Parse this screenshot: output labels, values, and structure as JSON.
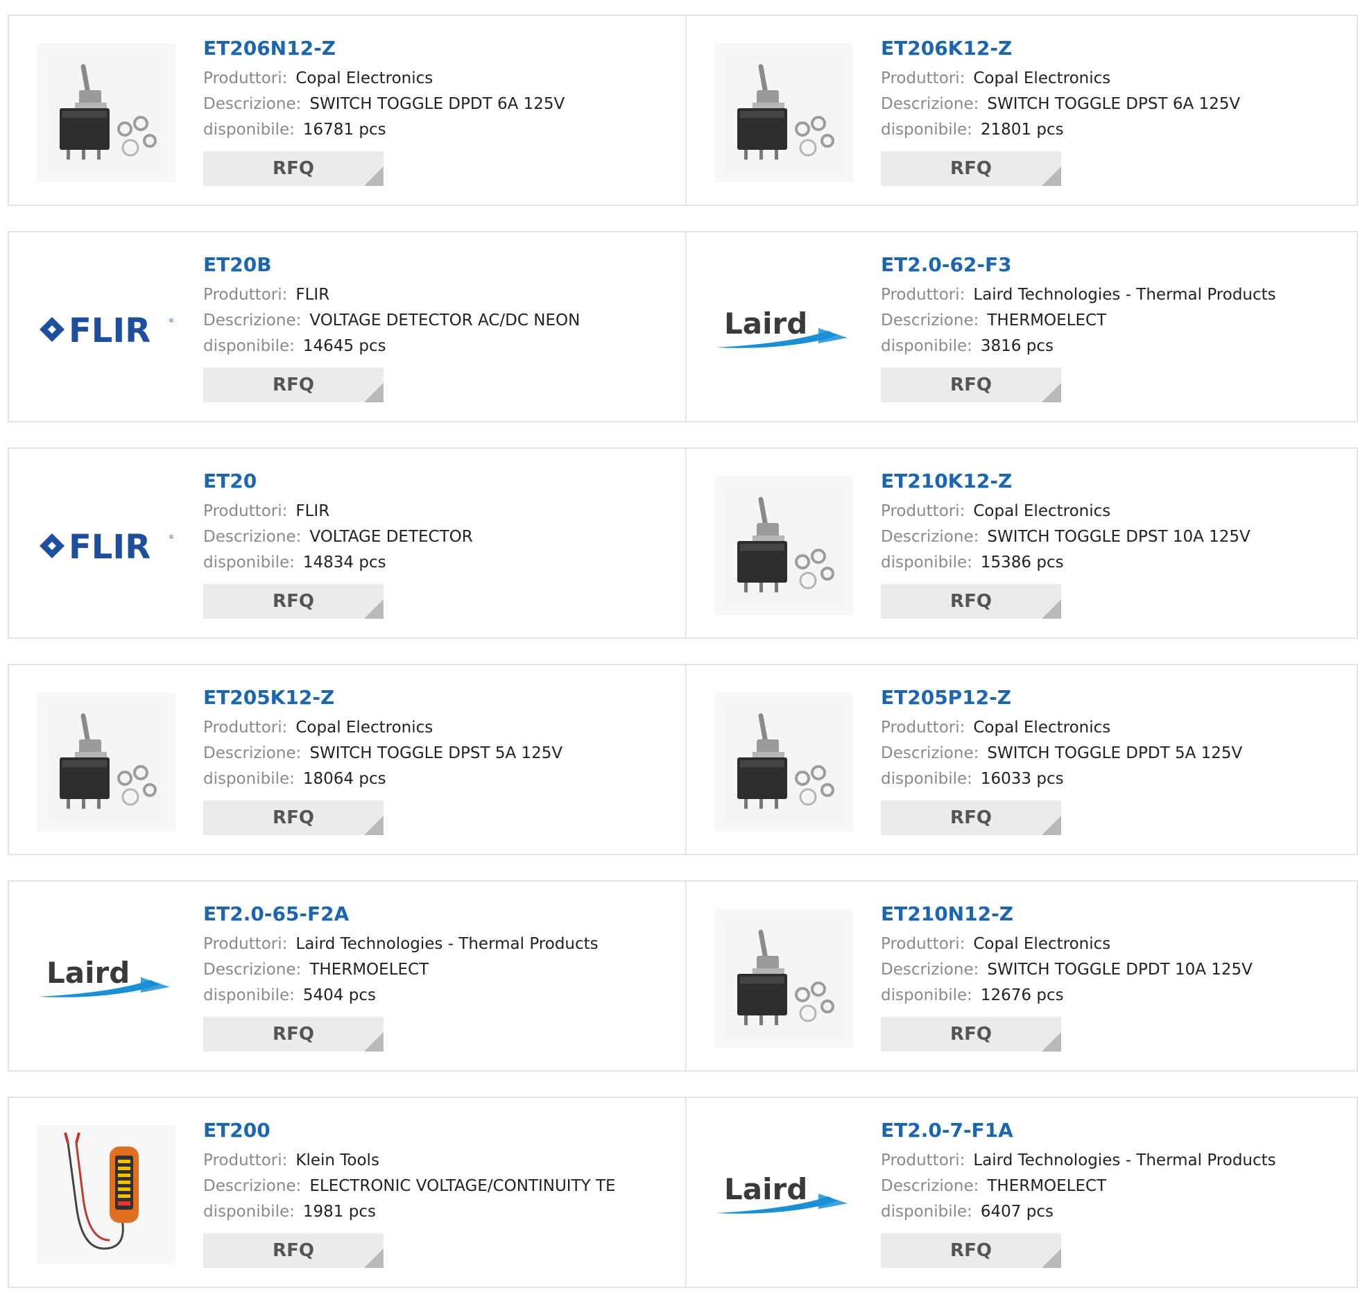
{
  "labels": {
    "manufacturer": "Produttori:",
    "description": "Descrizione:",
    "available": "disponibile:",
    "rfq": "RFQ"
  },
  "products": [
    {
      "part": "ET206N12-Z",
      "manufacturer": "Copal Electronics",
      "description": "SWITCH TOGGLE DPDT 6A 125V",
      "available": "16781 pcs",
      "image": "toggle-switch"
    },
    {
      "part": "ET206K12-Z",
      "manufacturer": "Copal Electronics",
      "description": "SWITCH TOGGLE DPST 6A 125V",
      "available": "21801 pcs",
      "image": "toggle-switch"
    },
    {
      "part": "ET20B",
      "manufacturer": "FLIR",
      "description": "VOLTAGE DETECTOR AC/DC NEON",
      "available": "14645 pcs",
      "image": "flir-logo"
    },
    {
      "part": "ET2.0-62-F3",
      "manufacturer": "Laird Technologies - Thermal Products",
      "description": "THERMOELECT",
      "available": "3816 pcs",
      "image": "laird-logo"
    },
    {
      "part": "ET20",
      "manufacturer": "FLIR",
      "description": "VOLTAGE DETECTOR",
      "available": "14834 pcs",
      "image": "flir-logo"
    },
    {
      "part": "ET210K12-Z",
      "manufacturer": "Copal Electronics",
      "description": "SWITCH TOGGLE DPST 10A 125V",
      "available": "15386 pcs",
      "image": "toggle-switch"
    },
    {
      "part": "ET205K12-Z",
      "manufacturer": "Copal Electronics",
      "description": "SWITCH TOGGLE DPST 5A 125V",
      "available": "18064 pcs",
      "image": "toggle-switch"
    },
    {
      "part": "ET205P12-Z",
      "manufacturer": "Copal Electronics",
      "description": "SWITCH TOGGLE DPDT 5A 125V",
      "available": "16033 pcs",
      "image": "toggle-switch"
    },
    {
      "part": "ET2.0-65-F2A",
      "manufacturer": "Laird Technologies - Thermal Products",
      "description": "THERMOELECT",
      "available": "5404 pcs",
      "image": "laird-logo"
    },
    {
      "part": "ET210N12-Z",
      "manufacturer": "Copal Electronics",
      "description": "SWITCH TOGGLE DPDT 10A 125V",
      "available": "12676 pcs",
      "image": "toggle-switch"
    },
    {
      "part": "ET200",
      "manufacturer": "Klein Tools",
      "description": "ELECTRONIC VOLTAGE/CONTINUITY TE",
      "available": "1981 pcs",
      "image": "voltage-tester"
    },
    {
      "part": "ET2.0-7-F1A",
      "manufacturer": "Laird Technologies - Thermal Products",
      "description": "THERMOELECT",
      "available": "6407 pcs",
      "image": "laird-logo"
    }
  ],
  "logos": {
    "flir": "FLIR",
    "laird": "Laird"
  },
  "colors": {
    "part_link": "#1a66b3",
    "label": "#8a8a8a",
    "value": "#222222",
    "rfq_bg": "#ebebeb",
    "card_border": "#e3e3e3",
    "flir_brand": "#1d4f9c",
    "laird_swoosh": "#1a8fd6"
  }
}
